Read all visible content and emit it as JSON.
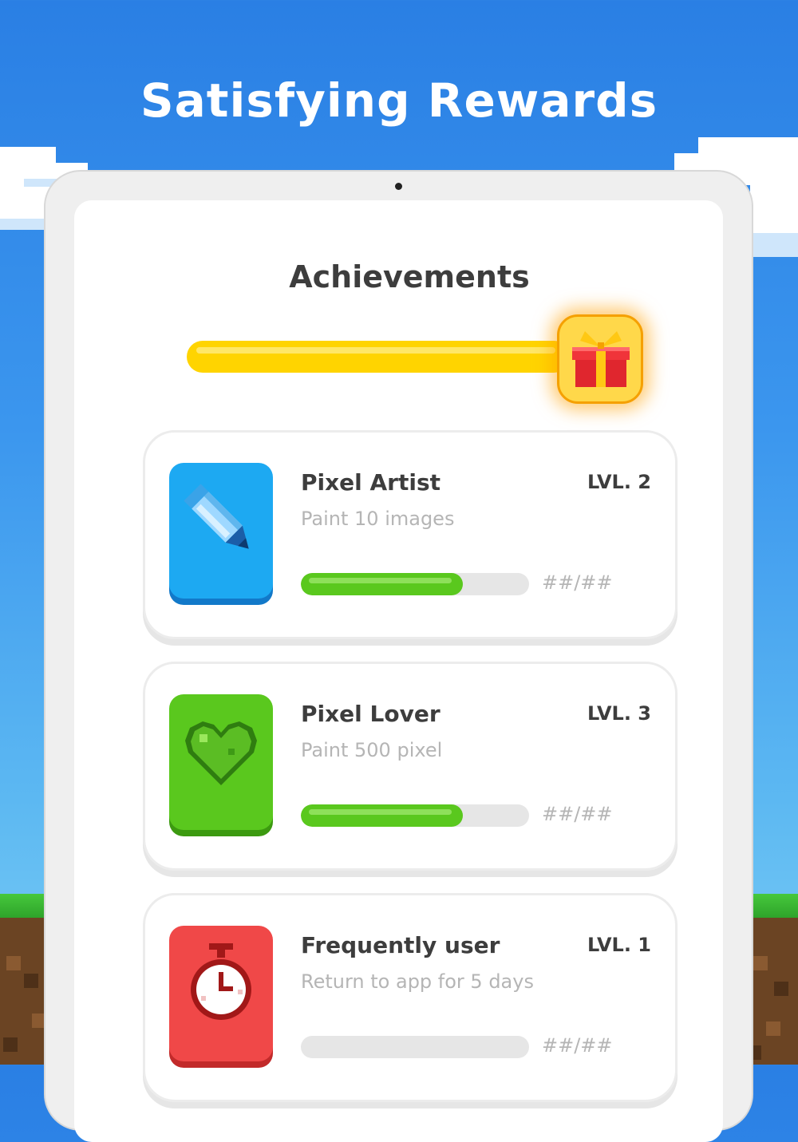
{
  "headline": "Satisfying Rewards",
  "screen": {
    "title": "Achievements",
    "goal_progress": 1.0,
    "goal_icon": "gift-icon"
  },
  "achievements": [
    {
      "title": "Pixel Artist",
      "level": "LVL. 2",
      "description": "Paint 10 images",
      "progress": 0.71,
      "count": "##/##",
      "icon": "pencil-icon",
      "color": "#1da9f2"
    },
    {
      "title": "Pixel Lover",
      "level": "LVL. 3",
      "description": "Paint 500 pixel",
      "progress": 0.71,
      "count": "##/##",
      "icon": "heart-icon",
      "color": "#5ac81e"
    },
    {
      "title": "Frequently user",
      "level": "LVL. 1",
      "description": "Return to app for 5 days",
      "progress": 0.0,
      "count": "##/##",
      "icon": "stopwatch-icon",
      "color": "#f04848"
    }
  ],
  "colors": {
    "sky": "#2a7fe4",
    "goal_bar": "#ffd400",
    "progress": "#5ac81e"
  }
}
